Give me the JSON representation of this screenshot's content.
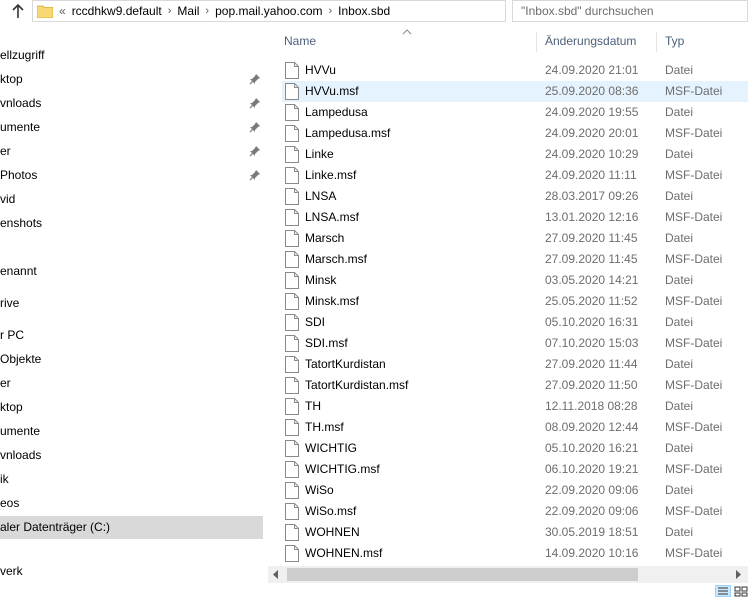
{
  "address_bar": {
    "overflow": "«",
    "crumbs": [
      "rccdhkw9.default",
      "Mail",
      "pop.mail.yahoo.com",
      "Inbox.sbd"
    ]
  },
  "search": {
    "placeholder": "\"Inbox.sbd\" durchsuchen"
  },
  "nav_pane": {
    "items": [
      {
        "label": "ellzugriff",
        "pinned": false
      },
      {
        "label": "ktop",
        "pinned": true
      },
      {
        "label": "vnloads",
        "pinned": true
      },
      {
        "label": "umente",
        "pinned": true
      },
      {
        "label": "er",
        "pinned": true
      },
      {
        "label": "Photos",
        "pinned": true
      },
      {
        "label": "vid",
        "pinned": false
      },
      {
        "label": "enshots",
        "pinned": false
      },
      {
        "label": "",
        "pinned": false
      },
      {
        "label": "enannt",
        "pinned": false
      },
      {
        "label": "",
        "pinned": false
      },
      {
        "label": "rive",
        "pinned": false
      },
      {
        "label": "",
        "pinned": false
      },
      {
        "label": "r PC",
        "pinned": false
      },
      {
        "label": "Objekte",
        "pinned": false
      },
      {
        "label": "er",
        "pinned": false
      },
      {
        "label": "ktop",
        "pinned": false
      },
      {
        "label": "umente",
        "pinned": false
      },
      {
        "label": "vnloads",
        "pinned": false
      },
      {
        "label": "ik",
        "pinned": false
      },
      {
        "label": "eos",
        "pinned": false
      },
      {
        "label": "aler Datenträger (C:)",
        "pinned": false,
        "selected": true
      },
      {
        "label": "",
        "pinned": false
      },
      {
        "label": "verk",
        "pinned": false
      },
      {
        "label": "",
        "pinned": false
      }
    ]
  },
  "columns": {
    "name": "Name",
    "date": "Änderungsdatum",
    "type": "Typ"
  },
  "files": [
    {
      "name": "HVVu",
      "date": "24.09.2020 21:01",
      "type": "Datei"
    },
    {
      "name": "HVVu.msf",
      "date": "25.09.2020 08:36",
      "type": "MSF-Datei",
      "hover": true
    },
    {
      "name": "Lampedusa",
      "date": "24.09.2020 19:55",
      "type": "Datei"
    },
    {
      "name": "Lampedusa.msf",
      "date": "24.09.2020 20:01",
      "type": "MSF-Datei"
    },
    {
      "name": "Linke",
      "date": "24.09.2020 10:29",
      "type": "Datei"
    },
    {
      "name": "Linke.msf",
      "date": "24.09.2020 11:11",
      "type": "MSF-Datei"
    },
    {
      "name": "LNSA",
      "date": "28.03.2017 09:26",
      "type": "Datei"
    },
    {
      "name": "LNSA.msf",
      "date": "13.01.2020 12:16",
      "type": "MSF-Datei"
    },
    {
      "name": "Marsch",
      "date": "27.09.2020 11:45",
      "type": "Datei"
    },
    {
      "name": "Marsch.msf",
      "date": "27.09.2020 11:45",
      "type": "MSF-Datei"
    },
    {
      "name": "Minsk",
      "date": "03.05.2020 14:21",
      "type": "Datei"
    },
    {
      "name": "Minsk.msf",
      "date": "25.05.2020 11:52",
      "type": "MSF-Datei"
    },
    {
      "name": "SDI",
      "date": "05.10.2020 16:31",
      "type": "Datei"
    },
    {
      "name": "SDI.msf",
      "date": "07.10.2020 15:03",
      "type": "MSF-Datei"
    },
    {
      "name": "TatortKurdistan",
      "date": "27.09.2020 11:44",
      "type": "Datei"
    },
    {
      "name": "TatortKurdistan.msf",
      "date": "27.09.2020 11:50",
      "type": "MSF-Datei"
    },
    {
      "name": "TH",
      "date": "12.11.2018 08:28",
      "type": "Datei"
    },
    {
      "name": "TH.msf",
      "date": "08.09.2020 12:44",
      "type": "MSF-Datei"
    },
    {
      "name": "WICHTIG",
      "date": "05.10.2020 16:21",
      "type": "Datei"
    },
    {
      "name": "WICHTIG.msf",
      "date": "06.10.2020 19:21",
      "type": "MSF-Datei"
    },
    {
      "name": "WiSo",
      "date": "22.09.2020 09:06",
      "type": "Datei"
    },
    {
      "name": "WiSo.msf",
      "date": "22.09.2020 09:06",
      "type": "MSF-Datei"
    },
    {
      "name": "WOHNEN",
      "date": "30.05.2019 18:51",
      "type": "Datei"
    },
    {
      "name": "WOHNEN.msf",
      "date": "14.09.2020 10:16",
      "type": "MSF-Datei"
    }
  ],
  "colors": {
    "hover_row": "#e5f3ff",
    "selected_nav": "#d9d9d9",
    "header_text": "#4c607a",
    "folder_yellow": "#f8d775"
  }
}
